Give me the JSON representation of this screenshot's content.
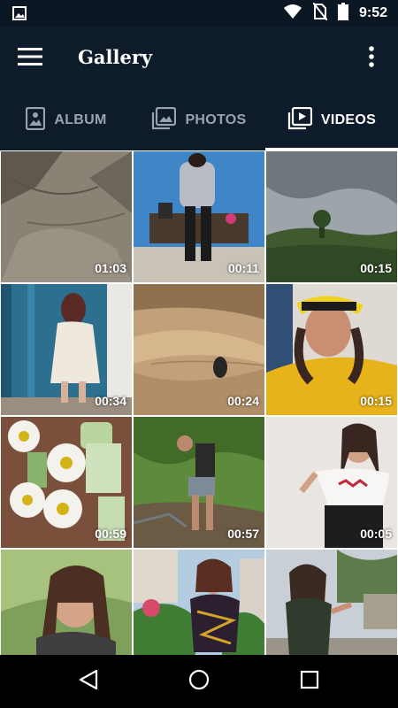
{
  "status_bar": {
    "time": "9:52",
    "icons": [
      "image-icon",
      "wifi-icon",
      "no-sim-icon",
      "battery-icon"
    ]
  },
  "app_bar": {
    "title": "Gallery",
    "icons": [
      "menu-icon",
      "more-vert-icon"
    ]
  },
  "tabs": [
    {
      "label": "ALBUM",
      "icon": "album-icon",
      "active": false
    },
    {
      "label": "PHOTOS",
      "icon": "photos-icon",
      "active": false
    },
    {
      "label": "VIDEOS",
      "icon": "video-library-icon",
      "active": true
    }
  ],
  "videos": [
    {
      "duration": "01:03"
    },
    {
      "duration": "00:11"
    },
    {
      "duration": "00:15"
    },
    {
      "duration": "00:34"
    },
    {
      "duration": "00:24"
    },
    {
      "duration": "00:15"
    },
    {
      "duration": "00:59"
    },
    {
      "duration": "00:57"
    },
    {
      "duration": "00:05"
    },
    {
      "duration": ""
    },
    {
      "duration": ""
    },
    {
      "duration": ""
    }
  ],
  "nav_bar": {
    "icons": [
      "back-icon",
      "home-icon",
      "recents-icon"
    ]
  },
  "colors": {
    "app_bar": "#0d1b2a",
    "status_bar": "#0b1623",
    "tab_inactive": "#9aa3ad",
    "tab_active": "#ffffff",
    "nav_bar": "#000000"
  }
}
